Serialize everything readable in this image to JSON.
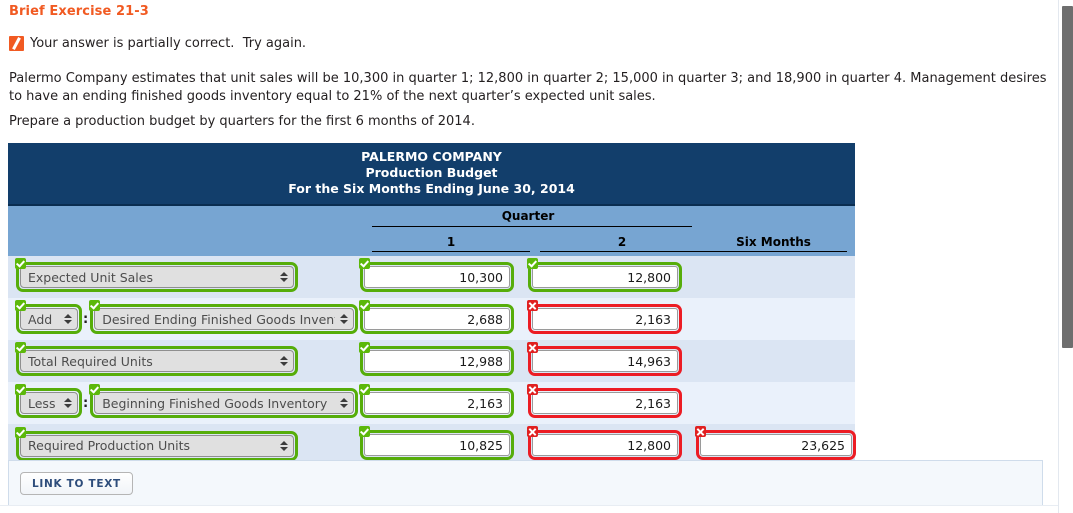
{
  "exercise": {
    "title": "Brief Exercise 21-3",
    "status_icon": "partial-correct-icon",
    "status_text": "Your answer is partially correct.  Try again.",
    "paragraph_1": "Palermo Company estimates that unit sales will be 10,300 in quarter 1; 12,800 in quarter 2; 15,000 in quarter 3; and 18,900 in quarter 4. Management desires to have an ending finished goods inventory equal to 21% of the next quarter’s expected unit sales.",
    "paragraph_2": "Prepare a production budget by quarters for the first 6 months of 2014."
  },
  "table": {
    "title_line_1": "PALERMO COMPANY",
    "title_line_2": "Production Budget",
    "title_line_3": "For the Six Months Ending June 30, 2014",
    "group_header": "Quarter",
    "col_q1": "1",
    "col_q2": "2",
    "col_six_months": "Six Months",
    "rows": [
      {
        "id": "expected-unit-sales",
        "operator": null,
        "label": "Expected Unit Sales",
        "label_state": "ok",
        "q1": {
          "value": "10,300",
          "state": "ok"
        },
        "q2": {
          "value": "12,800",
          "state": "ok"
        },
        "six": {
          "value": "",
          "state": "none"
        }
      },
      {
        "id": "desired-ending-finished-goods-inventory",
        "operator": "Add",
        "operator_state": "ok",
        "label": "Desired Ending Finished Goods Inventory",
        "label_state": "ok",
        "separator": ":",
        "q1": {
          "value": "2,688",
          "state": "ok"
        },
        "q2": {
          "value": "2,163",
          "state": "bad"
        },
        "six": {
          "value": "",
          "state": "none"
        }
      },
      {
        "id": "total-required-units",
        "operator": null,
        "label": "Total Required Units",
        "label_state": "ok",
        "q1": {
          "value": "12,988",
          "state": "ok"
        },
        "q2": {
          "value": "14,963",
          "state": "bad"
        },
        "six": {
          "value": "",
          "state": "none"
        }
      },
      {
        "id": "beginning-finished-goods-inventory",
        "operator": "Less",
        "operator_state": "ok",
        "label": "Beginning Finished Goods Inventory",
        "label_state": "ok",
        "separator": ":",
        "q1": {
          "value": "2,163",
          "state": "ok"
        },
        "q2": {
          "value": "2,163",
          "state": "bad"
        },
        "six": {
          "value": "",
          "state": "none"
        }
      },
      {
        "id": "required-production-units",
        "operator": null,
        "label": "Required Production Units",
        "label_state": "ok",
        "q1": {
          "value": "10,825",
          "state": "ok"
        },
        "q2": {
          "value": "12,800",
          "state": "bad"
        },
        "six": {
          "value": "23,625",
          "state": "bad"
        }
      }
    ]
  },
  "footer": {
    "link_to_text_label": "LINK TO TEXT"
  },
  "colors": {
    "accent_orange": "#f15a22",
    "header_navy": "#123e6b",
    "subheader_blue": "#77a5d2",
    "row_odd": "#dbe5f3",
    "row_even": "#eaf1fb",
    "valid_green": "#56ad0a",
    "invalid_red": "#ec1c24"
  }
}
